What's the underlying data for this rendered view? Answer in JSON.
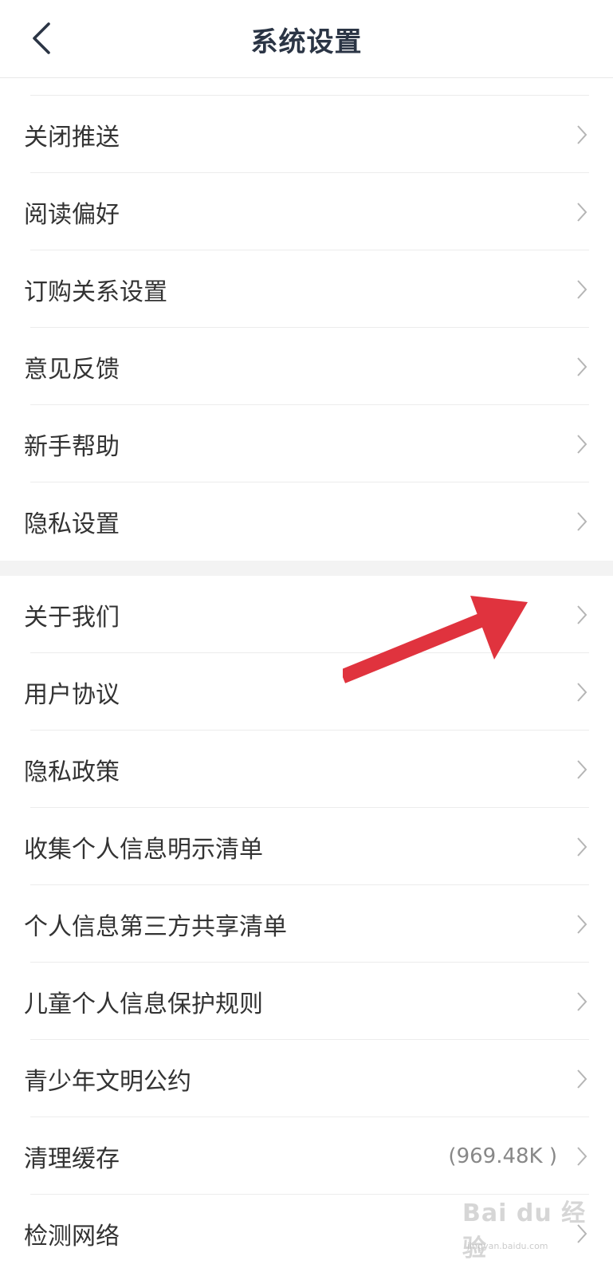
{
  "header": {
    "title": "系统设置",
    "back_icon": "chevron-left-icon"
  },
  "groups": [
    {
      "items": [
        {
          "label": "关闭推送"
        },
        {
          "label": "阅读偏好"
        },
        {
          "label": "订购关系设置"
        },
        {
          "label": "意见反馈"
        },
        {
          "label": "新手帮助"
        },
        {
          "label": "隐私设置"
        }
      ]
    },
    {
      "items": [
        {
          "label": "关于我们"
        },
        {
          "label": "用户协议"
        },
        {
          "label": "隐私政策"
        },
        {
          "label": "收集个人信息明示清单"
        },
        {
          "label": "个人信息第三方共享清单"
        },
        {
          "label": "儿童个人信息保护规则"
        },
        {
          "label": "青少年文明公约"
        },
        {
          "label": "清理缓存",
          "value": "(969.48K )"
        },
        {
          "label": "检测网络"
        }
      ]
    }
  ],
  "annotation": {
    "arrow_color": "#e0333e",
    "points_to": "关于我们"
  },
  "watermark": {
    "main": "Bai du 经验",
    "sub": "jingyan.baidu.com"
  },
  "colors": {
    "title": "#2b3545",
    "text": "#333333",
    "divider": "#ececec",
    "section_gap": "#f3f3f3",
    "chevron": "#b5b5b5"
  }
}
